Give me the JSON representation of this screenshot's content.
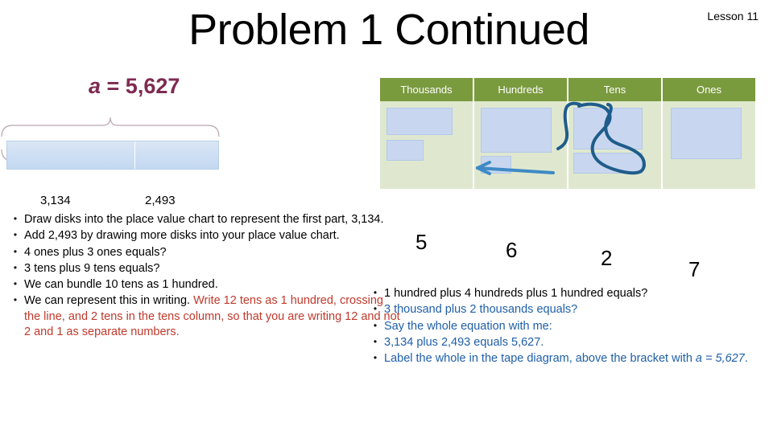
{
  "header": {
    "title": "Problem 1 Continued",
    "lesson": "Lesson 11"
  },
  "tape_diagram": {
    "whole_label_prefix": "a",
    "whole_label_rest": " = 5,627",
    "part1": "3,134",
    "part2": "2,493"
  },
  "place_value_chart": {
    "columns": [
      "Thousands",
      "Hundreds",
      "Tens",
      "Ones"
    ],
    "answer_digits": [
      "5",
      "6",
      "2",
      "7"
    ]
  },
  "bullets_left": [
    {
      "segments": [
        {
          "text": "Draw disks into the place value chart to represent the first part, 3,134.",
          "style": "plain"
        }
      ]
    },
    {
      "segments": [
        {
          "text": "Add 2,493 by drawing more disks into your place value chart.",
          "style": "plain"
        }
      ]
    },
    {
      "segments": [
        {
          "text": "4 ones plus 3 ones equals?",
          "style": "plain"
        }
      ]
    },
    {
      "segments": [
        {
          "text": "3  tens plus 9 tens equals?",
          "style": "plain"
        }
      ]
    },
    {
      "segments": [
        {
          "text": "We can bundle 10 tens as 1 hundred.",
          "style": "plain"
        }
      ]
    },
    {
      "segments": [
        {
          "text": "We can represent this in writing. ",
          "style": "plain"
        },
        {
          "text": "Write 12 tens as 1 hundred, crossing the line, and 2 tens in the tens column, so that you are writing 12 and not 2 and 1 as separate numbers.",
          "style": "red"
        }
      ]
    }
  ],
  "bullets_right": [
    {
      "segments": [
        {
          "text": "1 hundred plus 4 hundreds plus 1 hundred equals?",
          "style": "plain"
        }
      ]
    },
    {
      "segments": [
        {
          "text": "3 thousand plus 2 thousands equals?",
          "style": "blue"
        }
      ]
    },
    {
      "segments": [
        {
          "text": "Say the whole equation with me:",
          "style": "blue"
        }
      ]
    },
    {
      "segments": [
        {
          "text": "3,134 plus 2,493 equals 5,627.",
          "style": "blue"
        }
      ]
    },
    {
      "segments": [
        {
          "text": "Label the whole in the tape diagram, above the bracket with ",
          "style": "blue"
        },
        {
          "text": "a = 5,627",
          "style": "blue-italic"
        },
        {
          "text": ".",
          "style": "blue"
        }
      ]
    }
  ],
  "colors": {
    "header_green": "#7a9a3e",
    "chart_cell": "#dfe8cf",
    "disk_block": "#c8d7ef",
    "accent_red": "#c0392b",
    "accent_blue": "#1f5fa8",
    "title_maroon": "#7f2a50",
    "annotation_blue": "#1f5c8b"
  }
}
